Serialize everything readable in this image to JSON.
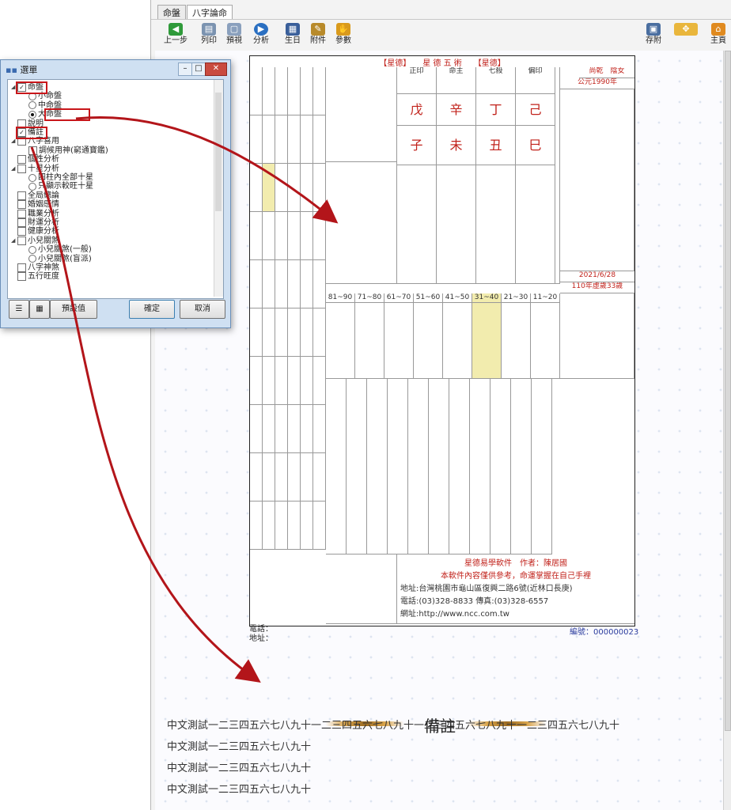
{
  "app": {
    "tabs": [
      "命盤",
      "八字論命"
    ],
    "toolbar": {
      "back": "上一步",
      "print": "列印",
      "preview": "預視",
      "analyze": "分析",
      "birthday": "生日",
      "attach": "附件",
      "params": "參數",
      "save_attach": "存附",
      "home": "主頁"
    }
  },
  "chart": {
    "banner": "【星德】　　星 德 五 術　　【星德】",
    "top_right": {
      "name_label": "尚乾",
      "zodiac": "陰女",
      "year": "公元1990年",
      "date_label": "2021/6/28",
      "age_label": "110年虛歲33歲"
    },
    "heavenly": [
      {
        "col": "正印",
        "stem": "戊",
        "branch": "子"
      },
      {
        "col": "命主",
        "stem": "辛",
        "branch": "未"
      },
      {
        "col": "七殺",
        "stem": "丁",
        "branch": "丑"
      },
      {
        "col": "偏印",
        "stem": "己",
        "branch": "巳"
      }
    ],
    "luck_labels": [
      "81~90",
      "71~80",
      "61~70",
      "51~60",
      "41~50",
      "31~40",
      "21~30",
      "11~20"
    ],
    "info": {
      "software": "星德易學軟件　作者：陳居國",
      "disclaimer": "本軟件內容僅供參考，命運掌握在自己手裡",
      "address": "地址:台灣桃園市龜山區復興二路6號(近林口長庚)",
      "phone": "電話:(03)328-8833 傳真:(03)328-6557",
      "website": "網址:http://www.ncc.com.tw"
    },
    "footer": {
      "phone_label": "電話：",
      "address_label": "地址：",
      "serial": "編號：000000023"
    }
  },
  "notes": {
    "title": "備註",
    "lines": [
      "中文測試一二三四五六七八九十一二三四五六七八九十一二三四五六七八九十一二三四五六七八九十",
      "中文測試一二三四五六七八九十",
      "中文測試一二三四五六七八九十",
      "中文測試一二三四五六七八九十"
    ]
  },
  "dialog": {
    "title": "選單",
    "tree": [
      {
        "label": "命盤",
        "type": "check",
        "checked": true,
        "level": 0
      },
      {
        "label": "小命盤",
        "type": "radio",
        "checked": false,
        "level": 1
      },
      {
        "label": "中命盤",
        "type": "radio",
        "checked": false,
        "level": 1
      },
      {
        "label": "大命盤",
        "type": "radio",
        "checked": true,
        "level": 1
      },
      {
        "label": "說明",
        "type": "check",
        "checked": false,
        "level": 0
      },
      {
        "label": "備註",
        "type": "check",
        "checked": true,
        "level": 0
      },
      {
        "label": "八字喜用",
        "type": "check",
        "checked": false,
        "level": 0
      },
      {
        "label": "調候用神(窮通寶鑑)",
        "type": "check",
        "checked": false,
        "level": 1
      },
      {
        "label": "個性分析",
        "type": "check",
        "checked": false,
        "level": 0
      },
      {
        "label": "十星分析",
        "type": "check",
        "checked": false,
        "level": 0
      },
      {
        "label": "四柱內全部十星",
        "type": "radio",
        "checked": false,
        "level": 1
      },
      {
        "label": "只顯示較旺十星",
        "type": "radio",
        "checked": false,
        "level": 1
      },
      {
        "label": "全局總論",
        "type": "check",
        "checked": false,
        "level": 0
      },
      {
        "label": "婚姻感情",
        "type": "check",
        "checked": false,
        "level": 0
      },
      {
        "label": "職業分析",
        "type": "check",
        "checked": false,
        "level": 0
      },
      {
        "label": "財運分析",
        "type": "check",
        "checked": false,
        "level": 0
      },
      {
        "label": "健康分析",
        "type": "check",
        "checked": false,
        "level": 0
      },
      {
        "label": "小兒關煞",
        "type": "check",
        "checked": false,
        "level": 0
      },
      {
        "label": "小兒關煞(一般)",
        "type": "radio",
        "checked": false,
        "level": 1
      },
      {
        "label": "小兒關煞(盲派)",
        "type": "radio",
        "checked": false,
        "level": 1
      },
      {
        "label": "八字神煞",
        "type": "check",
        "checked": false,
        "level": 0
      },
      {
        "label": "五行旺度",
        "type": "check",
        "checked": false,
        "level": 0
      }
    ],
    "buttons": {
      "default": "預設值",
      "ok": "確定",
      "cancel": "取消"
    }
  },
  "colors": {
    "accent_red": "#c8161a",
    "dialog_bg": "#cfe0f2",
    "chart_red": "#c1221b"
  }
}
